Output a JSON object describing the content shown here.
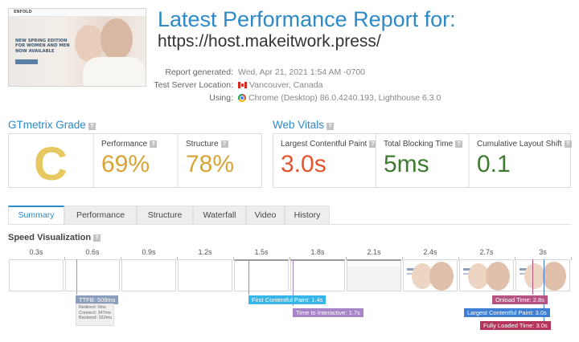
{
  "header": {
    "title": "Latest Performance Report for:",
    "url": "https://host.makeitwork.press/",
    "thumbnail": {
      "logo_text": "ENFOLD",
      "promo_text": "NEW SPRING EDITION FOR WOMEN AND MEN NOW AVAILABLE"
    }
  },
  "meta": {
    "report_generated_label": "Report generated:",
    "report_generated_value": "Wed, Apr 21, 2021 1:54 AM -0700",
    "server_location_label": "Test Server Location:",
    "server_location_value": "Vancouver, Canada",
    "using_label": "Using:",
    "using_value": "Chrome (Desktop) 86.0.4240.193, Lighthouse 6.3.0"
  },
  "gtmetrix_grade": {
    "title": "GTmetrix Grade",
    "grade": "C",
    "performance_label": "Performance",
    "performance_value": "69%",
    "structure_label": "Structure",
    "structure_value": "78%"
  },
  "web_vitals": {
    "title": "Web Vitals",
    "lcp_label": "Largest Contentful Paint",
    "lcp_value": "3.0s",
    "tbt_label": "Total Blocking Time",
    "tbt_value": "5ms",
    "cls_label": "Cumulative Layout Shift",
    "cls_value": "0.1"
  },
  "tabs": [
    "Summary",
    "Performance",
    "Structure",
    "Waterfall",
    "Video",
    "History"
  ],
  "active_tab": "Summary",
  "speed_visualization": {
    "title": "Speed Visualization",
    "ticks": [
      "0.3s",
      "0.6s",
      "0.9s",
      "1.2s",
      "1.5s",
      "1.8s",
      "2.1s",
      "2.4s",
      "2.7s",
      "3s"
    ],
    "markers": {
      "ttfb": "TTFB: 509ms",
      "ttfb_redirect": "Redirect: 0ms",
      "ttfb_connect": "Connect: 347ms",
      "ttfb_backend": "Backend: 162ms",
      "fcp": "First Contentful Paint: 1.4s",
      "tti": "Time to Interactive: 1.7s",
      "onload": "Onload Time: 2.8s",
      "lcp": "Largest Contentful Paint: 3.0s",
      "fully_loaded": "Fully Loaded Time: 3.0s"
    }
  },
  "colors": {
    "accent": "#2d89c8",
    "grade_c": "#e7c860",
    "percent_yellow": "#d9a436",
    "lcp_red": "#e5542e",
    "good_green": "#3d7c2f",
    "ttfb_marker": "#8a9dbd",
    "fcp_marker": "#36b5e8",
    "tti_marker": "#a684c7",
    "onload_marker": "#b55382",
    "lcp_marker": "#3d7fd5",
    "fully_loaded_marker": "#b4355b"
  }
}
